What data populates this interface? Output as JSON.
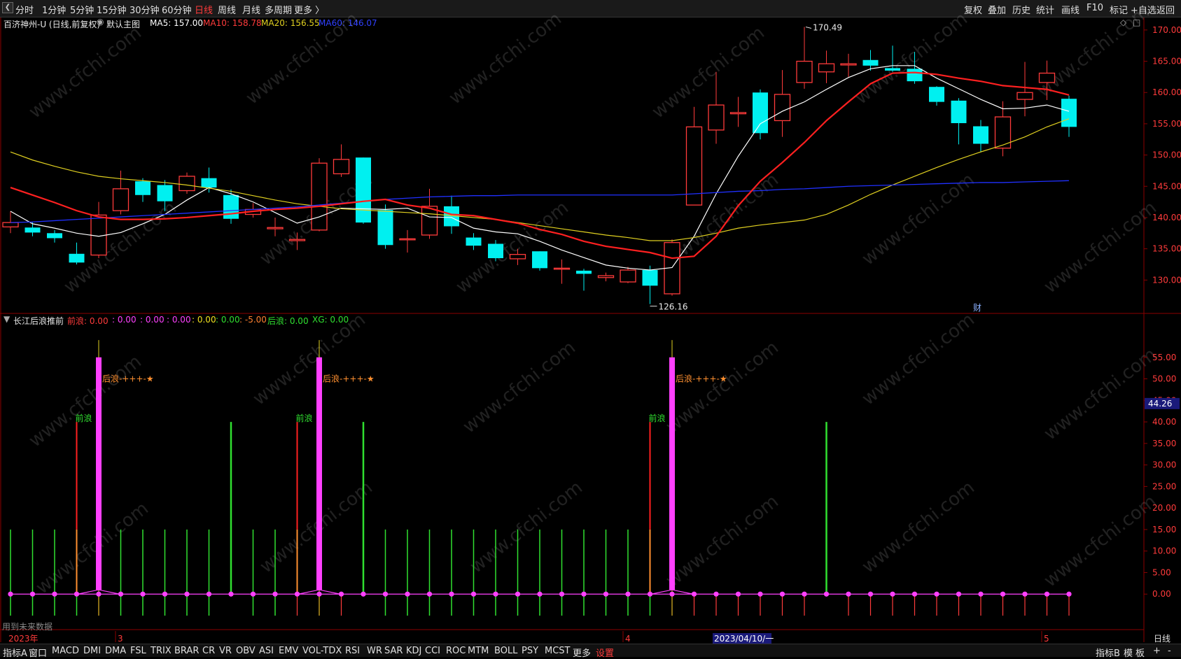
{
  "topbar": {
    "periods": [
      "分时",
      "1分钟",
      "5分钟",
      "15分钟",
      "30分钟",
      "60分钟",
      "日线",
      "周线",
      "月线",
      "多周期",
      "更多 〉"
    ],
    "active_period": "日线",
    "right_buttons": [
      "复权",
      "叠加",
      "历史",
      "统计",
      "画线",
      "F10",
      "标记",
      "+自选",
      "返回"
    ]
  },
  "main_header": {
    "stock": "百济神州-U (日线,前复权)",
    "template": "默认主图",
    "ma5": "MA5: 157.00",
    "ma10": "MA10: 158.78",
    "ma20": "MA20: 156.55",
    "ma60": "MA60: 146.07"
  },
  "indicator_header": {
    "name": "长江后浪推前",
    "qianlang": "前浪: 0.00",
    "v1": ": 0.00",
    "v2": ": 0.00",
    "v3": ": 0.00",
    "v4": ": 0.00",
    "v5": ": 0.00",
    "v6": ": -5.00",
    "houlang": "后浪: 0.00",
    "xg": "XG: 0.00"
  },
  "chart_data": {
    "type": "candlestick",
    "price_ylim": [
      125,
      172
    ],
    "price_ticks": [
      "170.00",
      "165.00",
      "160.00",
      "155.00",
      "150.00",
      "145.00",
      "140.00",
      "135.00",
      "130.00"
    ],
    "high_label": "170.49",
    "low_label": "126.16",
    "candles": [
      {
        "o": 138.5,
        "c": 139.2,
        "h": 141,
        "l": 137.5
      },
      {
        "o": 138.4,
        "c": 137.6,
        "h": 139.3,
        "l": 137
      },
      {
        "o": 137.5,
        "c": 136.7,
        "h": 138,
        "l": 136
      },
      {
        "o": 134.2,
        "c": 132.8,
        "h": 136,
        "l": 132.5
      },
      {
        "o": 134.0,
        "c": 140.4,
        "h": 142.5,
        "l": 133.5
      },
      {
        "o": 141.1,
        "c": 144.6,
        "h": 147.5,
        "l": 140.5
      },
      {
        "o": 145.8,
        "c": 143.6,
        "h": 146.3,
        "l": 142.5
      },
      {
        "o": 145.2,
        "c": 142.6,
        "h": 146,
        "l": 141
      },
      {
        "o": 144.3,
        "c": 146.6,
        "h": 147.2,
        "l": 143.8
      },
      {
        "o": 146.3,
        "c": 144.8,
        "h": 148,
        "l": 144
      },
      {
        "o": 143.6,
        "c": 139.8,
        "h": 144.5,
        "l": 139
      },
      {
        "o": 140.5,
        "c": 141.3,
        "h": 142.3,
        "l": 140
      },
      {
        "o": 138.2,
        "c": 138.4,
        "h": 140,
        "l": 137
      },
      {
        "o": 136.3,
        "c": 136.5,
        "h": 137.6,
        "l": 134.8
      },
      {
        "o": 138.0,
        "c": 148.7,
        "h": 149.5,
        "l": 137.8
      },
      {
        "o": 147.0,
        "c": 149.3,
        "h": 151.7,
        "l": 146.5
      },
      {
        "o": 149.6,
        "c": 139.2,
        "h": 149.6,
        "l": 139
      },
      {
        "o": 141.2,
        "c": 135.6,
        "h": 142.1,
        "l": 135
      },
      {
        "o": 136.5,
        "c": 136.6,
        "h": 138,
        "l": 134.4
      },
      {
        "o": 137.2,
        "c": 141.8,
        "h": 144.6,
        "l": 136.6
      },
      {
        "o": 141.8,
        "c": 138.6,
        "h": 143.5,
        "l": 137.4
      },
      {
        "o": 136.8,
        "c": 135.5,
        "h": 137.5,
        "l": 134.8
      },
      {
        "o": 135.8,
        "c": 133.5,
        "h": 136.4,
        "l": 133
      },
      {
        "o": 133.4,
        "c": 134.1,
        "h": 135,
        "l": 132.4
      },
      {
        "o": 134.6,
        "c": 131.9,
        "h": 134.6,
        "l": 131.5
      },
      {
        "o": 131.8,
        "c": 131.9,
        "h": 133.3,
        "l": 129.4
      },
      {
        "o": 131.5,
        "c": 131.0,
        "h": 131.8,
        "l": 128.3
      },
      {
        "o": 130.4,
        "c": 130.7,
        "h": 131.2,
        "l": 129.8
      },
      {
        "o": 129.7,
        "c": 131.6,
        "h": 132.1,
        "l": 129.5
      },
      {
        "o": 131.6,
        "c": 129.1,
        "h": 132.3,
        "l": 126.16
      },
      {
        "o": 127.8,
        "c": 136.0,
        "h": 136.5,
        "l": 127.5
      },
      {
        "o": 142.0,
        "c": 154.5,
        "h": 157.7,
        "l": 142
      },
      {
        "o": 154.0,
        "c": 158.0,
        "h": 163.3,
        "l": 151.8
      },
      {
        "o": 156.6,
        "c": 156.8,
        "h": 159.3,
        "l": 154.5
      },
      {
        "o": 160.0,
        "c": 153.5,
        "h": 160.5,
        "l": 152.5
      },
      {
        "o": 155.5,
        "c": 159.7,
        "h": 163.6,
        "l": 152.9
      },
      {
        "o": 161.6,
        "c": 165.0,
        "h": 170.49,
        "l": 160.6
      },
      {
        "o": 163.3,
        "c": 164.6,
        "h": 166.7,
        "l": 161.5
      },
      {
        "o": 164.4,
        "c": 164.6,
        "h": 166.2,
        "l": 162.5
      },
      {
        "o": 165.2,
        "c": 164.3,
        "h": 166.8,
        "l": 163.5
      },
      {
        "o": 163.9,
        "c": 163.5,
        "h": 167.5,
        "l": 163.3
      },
      {
        "o": 163.8,
        "c": 161.8,
        "h": 166.5,
        "l": 161.4
      },
      {
        "o": 160.9,
        "c": 158.5,
        "h": 161,
        "l": 157.9
      },
      {
        "o": 158.7,
        "c": 155.1,
        "h": 159.1,
        "l": 151.7
      },
      {
        "o": 154.6,
        "c": 151.8,
        "h": 155.6,
        "l": 150.5
      },
      {
        "o": 151.1,
        "c": 156.1,
        "h": 158.6,
        "l": 149.8
      },
      {
        "o": 158.9,
        "c": 160.0,
        "h": 164.9,
        "l": 156.2
      },
      {
        "o": 161.6,
        "c": 163.1,
        "h": 165.1,
        "l": 158.8
      },
      {
        "o": 159.0,
        "c": 154.5,
        "h": 159.5,
        "l": 152.9
      }
    ],
    "ma5": [
      141.0,
      139.0,
      138.3,
      137.5,
      137.0,
      137.6,
      139.0,
      140.5,
      142.8,
      144.8,
      143.8,
      142.5,
      140.8,
      139.1,
      140.1,
      141.5,
      141.4,
      141.3,
      141.5,
      140.1,
      140.0,
      138.3,
      137.7,
      137.4,
      136.2,
      134.8,
      133.6,
      132.4,
      131.9,
      131.6,
      132.0,
      137.0,
      143.8,
      149.8,
      155.0,
      157.0,
      158.5,
      160.5,
      162.4,
      163.8,
      164.3,
      164.3,
      162.3,
      160.6,
      158.9,
      157.4,
      157.5,
      158.0,
      157.0
    ],
    "ma10": [
      144.8,
      143.6,
      142.4,
      141.1,
      140.1,
      139.7,
      139.7,
      139.8,
      140.0,
      140.3,
      140.6,
      141.0,
      141.3,
      141.5,
      141.8,
      142.2,
      142.6,
      142.9,
      142.0,
      141.5,
      140.5,
      140.3,
      139.7,
      139.1,
      138.1,
      137.3,
      136.2,
      135.4,
      134.9,
      134.4,
      133.5,
      133.8,
      137.0,
      141.9,
      145.8,
      148.8,
      152.0,
      155.5,
      158.5,
      161.4,
      163.1,
      163.2,
      162.9,
      162.3,
      161.8,
      161.1,
      160.8,
      160.5,
      159.6
    ],
    "ma20": [
      150.5,
      149.2,
      148.2,
      147.3,
      146.6,
      146.2,
      145.9,
      145.6,
      145.2,
      144.7,
      144.2,
      143.5,
      142.8,
      142.2,
      141.8,
      141.4,
      141.2,
      141.0,
      140.8,
      140.6,
      140.3,
      140.0,
      139.7,
      139.2,
      138.7,
      138.2,
      137.7,
      137.2,
      136.8,
      136.3,
      136.3,
      136.8,
      137.5,
      138.3,
      138.8,
      139.2,
      139.6,
      140.5,
      142.0,
      143.7,
      145.2,
      146.6,
      148.0,
      149.3,
      150.5,
      151.6,
      152.9,
      154.5,
      155.8
    ],
    "ma60": [
      139.2,
      139.3,
      139.5,
      139.7,
      139.9,
      140.1,
      140.3,
      140.5,
      140.7,
      140.9,
      141.1,
      141.3,
      141.5,
      141.7,
      142.0,
      142.3,
      142.6,
      142.9,
      143.1,
      143.3,
      143.4,
      143.5,
      143.5,
      143.6,
      143.6,
      143.6,
      143.6,
      143.6,
      143.6,
      143.6,
      143.6,
      143.8,
      144.0,
      144.2,
      144.3,
      144.5,
      144.6,
      144.8,
      145.0,
      145.1,
      145.2,
      145.3,
      145.4,
      145.5,
      145.6,
      145.6,
      145.7,
      145.8,
      145.9
    ],
    "ind_ylim": [
      -5,
      60
    ],
    "ind_ticks": [
      "55.00",
      "50.00",
      "45.00",
      "40.00",
      "35.00",
      "30.00",
      "25.00",
      "20.00",
      "15.00",
      "10.00",
      "5.00",
      "0.00"
    ],
    "ind_current": "44.26",
    "wave_signals": [
      {
        "index": 3,
        "label": "前浪"
      },
      {
        "index": 13,
        "label": "前浪"
      },
      {
        "index": 29,
        "label": "前浪"
      }
    ],
    "pink_spikes": [
      {
        "index": 4,
        "label": "后浪-+++-★"
      },
      {
        "index": 14,
        "label": "后浪-+++-★"
      },
      {
        "index": 30,
        "label": "后浪-+++-★"
      }
    ],
    "green_tall": [
      10,
      16,
      37
    ],
    "green_short": [
      0,
      1,
      2,
      3,
      5,
      6,
      7,
      8,
      9,
      11,
      12,
      17,
      18,
      19,
      20,
      21,
      22,
      23,
      24,
      25,
      26,
      27,
      28,
      29
    ]
  },
  "axis": {
    "year_label": "2023年",
    "month_labels": [
      "3",
      "4",
      "5"
    ],
    "cursor_date": "2023/04/10/一",
    "fin_marker": "财",
    "future_label": "用到未来数据",
    "period_label": "日线"
  },
  "bottombar": {
    "items": [
      "指标A",
      "窗口",
      "MACD",
      "DMI",
      "DMA",
      "FSL",
      "TRIX",
      "BRAR",
      "CR",
      "VR",
      "OBV",
      "ASI",
      "EMV",
      "VOL-TDX",
      "RSI",
      "WR",
      "SAR",
      "KDJ",
      "CCI",
      "ROC",
      "MTM",
      "BOLL",
      "PSY",
      "MCST",
      "更多",
      "设置"
    ],
    "right": [
      "指标B",
      "模",
      "板",
      "+",
      "-"
    ]
  },
  "colors": {
    "up": "#ff3b3b",
    "down": "#00f0f0",
    "ma5": "#ffffff",
    "ma10": "#ff2020",
    "ma20": "#e0d020",
    "ma60": "#2030ff",
    "pink": "#ff40ff",
    "green": "#30e030"
  },
  "watermark": "www.cfchi.com"
}
